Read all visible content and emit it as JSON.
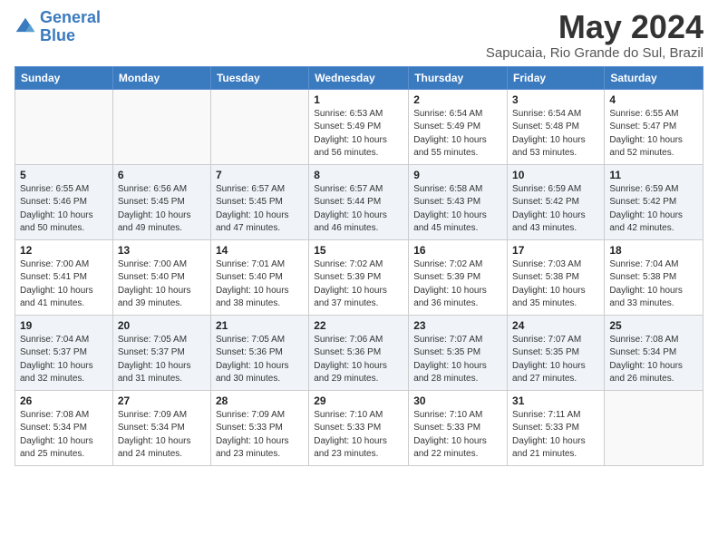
{
  "logo": {
    "line1": "General",
    "line2": "Blue"
  },
  "title": "May 2024",
  "subtitle": "Sapucaia, Rio Grande do Sul, Brazil",
  "days_of_week": [
    "Sunday",
    "Monday",
    "Tuesday",
    "Wednesday",
    "Thursday",
    "Friday",
    "Saturday"
  ],
  "weeks": [
    [
      {
        "day": "",
        "info": ""
      },
      {
        "day": "",
        "info": ""
      },
      {
        "day": "",
        "info": ""
      },
      {
        "day": "1",
        "info": "Sunrise: 6:53 AM\nSunset: 5:49 PM\nDaylight: 10 hours\nand 56 minutes."
      },
      {
        "day": "2",
        "info": "Sunrise: 6:54 AM\nSunset: 5:49 PM\nDaylight: 10 hours\nand 55 minutes."
      },
      {
        "day": "3",
        "info": "Sunrise: 6:54 AM\nSunset: 5:48 PM\nDaylight: 10 hours\nand 53 minutes."
      },
      {
        "day": "4",
        "info": "Sunrise: 6:55 AM\nSunset: 5:47 PM\nDaylight: 10 hours\nand 52 minutes."
      }
    ],
    [
      {
        "day": "5",
        "info": "Sunrise: 6:55 AM\nSunset: 5:46 PM\nDaylight: 10 hours\nand 50 minutes."
      },
      {
        "day": "6",
        "info": "Sunrise: 6:56 AM\nSunset: 5:45 PM\nDaylight: 10 hours\nand 49 minutes."
      },
      {
        "day": "7",
        "info": "Sunrise: 6:57 AM\nSunset: 5:45 PM\nDaylight: 10 hours\nand 47 minutes."
      },
      {
        "day": "8",
        "info": "Sunrise: 6:57 AM\nSunset: 5:44 PM\nDaylight: 10 hours\nand 46 minutes."
      },
      {
        "day": "9",
        "info": "Sunrise: 6:58 AM\nSunset: 5:43 PM\nDaylight: 10 hours\nand 45 minutes."
      },
      {
        "day": "10",
        "info": "Sunrise: 6:59 AM\nSunset: 5:42 PM\nDaylight: 10 hours\nand 43 minutes."
      },
      {
        "day": "11",
        "info": "Sunrise: 6:59 AM\nSunset: 5:42 PM\nDaylight: 10 hours\nand 42 minutes."
      }
    ],
    [
      {
        "day": "12",
        "info": "Sunrise: 7:00 AM\nSunset: 5:41 PM\nDaylight: 10 hours\nand 41 minutes."
      },
      {
        "day": "13",
        "info": "Sunrise: 7:00 AM\nSunset: 5:40 PM\nDaylight: 10 hours\nand 39 minutes."
      },
      {
        "day": "14",
        "info": "Sunrise: 7:01 AM\nSunset: 5:40 PM\nDaylight: 10 hours\nand 38 minutes."
      },
      {
        "day": "15",
        "info": "Sunrise: 7:02 AM\nSunset: 5:39 PM\nDaylight: 10 hours\nand 37 minutes."
      },
      {
        "day": "16",
        "info": "Sunrise: 7:02 AM\nSunset: 5:39 PM\nDaylight: 10 hours\nand 36 minutes."
      },
      {
        "day": "17",
        "info": "Sunrise: 7:03 AM\nSunset: 5:38 PM\nDaylight: 10 hours\nand 35 minutes."
      },
      {
        "day": "18",
        "info": "Sunrise: 7:04 AM\nSunset: 5:38 PM\nDaylight: 10 hours\nand 33 minutes."
      }
    ],
    [
      {
        "day": "19",
        "info": "Sunrise: 7:04 AM\nSunset: 5:37 PM\nDaylight: 10 hours\nand 32 minutes."
      },
      {
        "day": "20",
        "info": "Sunrise: 7:05 AM\nSunset: 5:37 PM\nDaylight: 10 hours\nand 31 minutes."
      },
      {
        "day": "21",
        "info": "Sunrise: 7:05 AM\nSunset: 5:36 PM\nDaylight: 10 hours\nand 30 minutes."
      },
      {
        "day": "22",
        "info": "Sunrise: 7:06 AM\nSunset: 5:36 PM\nDaylight: 10 hours\nand 29 minutes."
      },
      {
        "day": "23",
        "info": "Sunrise: 7:07 AM\nSunset: 5:35 PM\nDaylight: 10 hours\nand 28 minutes."
      },
      {
        "day": "24",
        "info": "Sunrise: 7:07 AM\nSunset: 5:35 PM\nDaylight: 10 hours\nand 27 minutes."
      },
      {
        "day": "25",
        "info": "Sunrise: 7:08 AM\nSunset: 5:34 PM\nDaylight: 10 hours\nand 26 minutes."
      }
    ],
    [
      {
        "day": "26",
        "info": "Sunrise: 7:08 AM\nSunset: 5:34 PM\nDaylight: 10 hours\nand 25 minutes."
      },
      {
        "day": "27",
        "info": "Sunrise: 7:09 AM\nSunset: 5:34 PM\nDaylight: 10 hours\nand 24 minutes."
      },
      {
        "day": "28",
        "info": "Sunrise: 7:09 AM\nSunset: 5:33 PM\nDaylight: 10 hours\nand 23 minutes."
      },
      {
        "day": "29",
        "info": "Sunrise: 7:10 AM\nSunset: 5:33 PM\nDaylight: 10 hours\nand 23 minutes."
      },
      {
        "day": "30",
        "info": "Sunrise: 7:10 AM\nSunset: 5:33 PM\nDaylight: 10 hours\nand 22 minutes."
      },
      {
        "day": "31",
        "info": "Sunrise: 7:11 AM\nSunset: 5:33 PM\nDaylight: 10 hours\nand 21 minutes."
      },
      {
        "day": "",
        "info": ""
      }
    ]
  ]
}
